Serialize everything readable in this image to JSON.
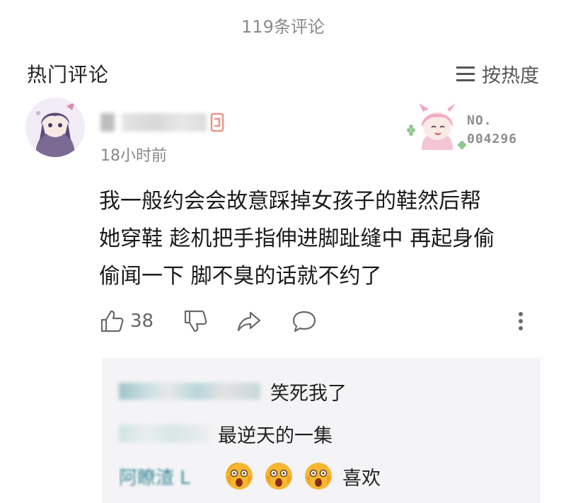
{
  "header": {
    "comment_count": "119条评论"
  },
  "section": {
    "title": "热门评论",
    "sort_label": "按热度"
  },
  "comment": {
    "timestamp": "18小时前",
    "badge_no": "NO.",
    "badge_number": "004296",
    "lines": [
      "我一般约会会故意踩掉女孩子的鞋然后帮",
      "她穿鞋 趁机把手指伸进脚趾缝中 再起身偷",
      "偷闻一下 脚不臭的话就不约了"
    ],
    "like_count": "38"
  },
  "replies": [
    {
      "text": "笑死我了"
    },
    {
      "text": "最逆天的一集"
    },
    {
      "name_fragment": "阿瞭渣 L",
      "text": "喜欢",
      "emojis": [
        "scream-emoji",
        "scream-emoji",
        "scream-emoji"
      ]
    }
  ],
  "colors": {
    "text": "#222222",
    "muted": "#888888",
    "reply_bg": "#f4f4f6",
    "emoji_yellow": "#f5b731"
  },
  "icons": [
    "menu-icon",
    "thumbs-up-icon",
    "thumbs-down-icon",
    "share-icon",
    "reply-bubble-icon",
    "more-vertical-icon"
  ]
}
